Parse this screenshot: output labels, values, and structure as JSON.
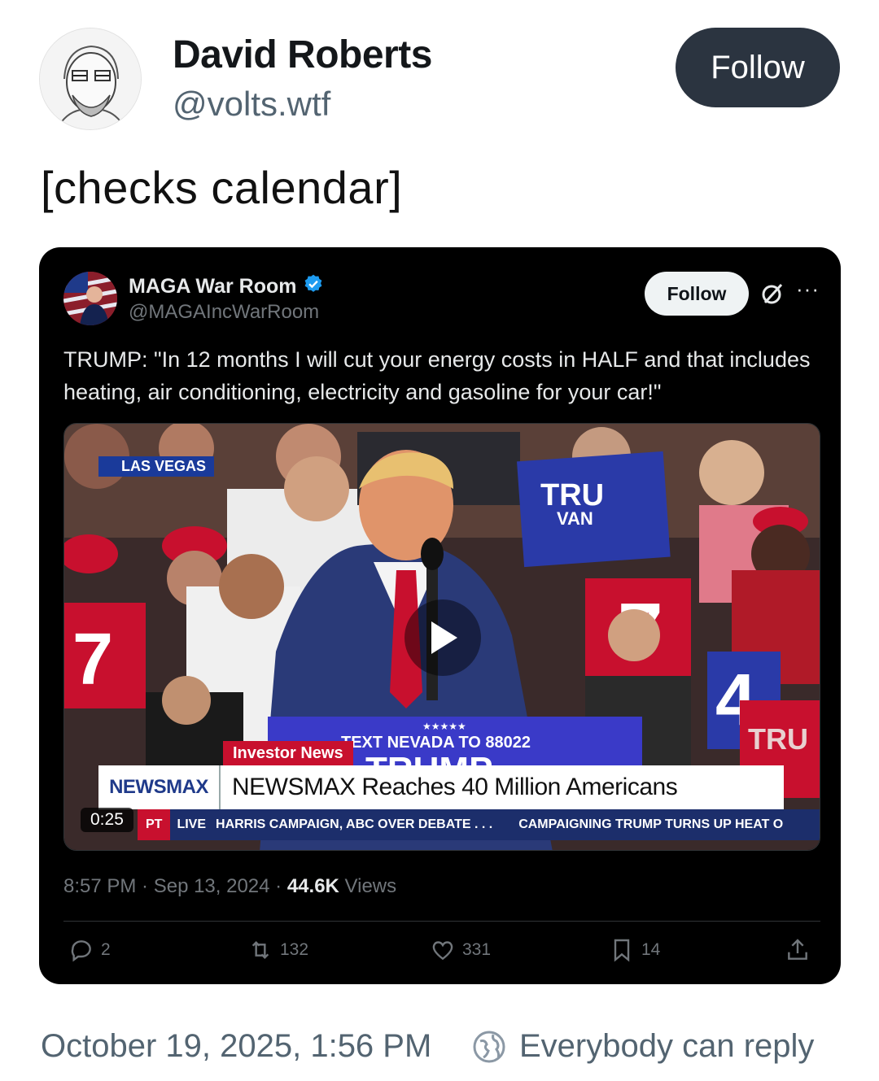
{
  "author": {
    "name": "David Roberts",
    "handle": "@volts.wtf"
  },
  "follow_label": "Follow",
  "post_text": "[checks calendar]",
  "embed": {
    "name": "MAGA War Room",
    "handle": "@MAGAIncWarRoom",
    "follow_label": "Follow",
    "more": "···",
    "text": "TRUMP: \"In 12 months I will cut your energy costs in HALF and that includes heating, air conditioning, electricity and gasoline for your car!\"",
    "video": {
      "location_tag": "LAS VEGAS",
      "lower_tag": "Investor News",
      "chyron_logo": "NEWSMAX",
      "chyron_text": "NEWSMAX Reaches 40 Million Americans",
      "ticker_pt": "PT",
      "ticker_live": "LIVE",
      "ticker_1": "HARRIS CAMPAIGN, ABC OVER DEBATE . . .",
      "ticker_2": "CAMPAIGNING TRUMP TURNS UP HEAT O",
      "duration": "0:25"
    },
    "meta": {
      "time": "8:57 PM · Sep 13, 2024 · ",
      "views_count": "44.6K",
      "views_label": " Views"
    },
    "actions": {
      "replies": "2",
      "reposts": "132",
      "likes": "331",
      "bookmarks": "14"
    }
  },
  "footer": {
    "date": "October 19, 2025, 1:56 PM",
    "reply_setting": "Everybody can reply"
  },
  "colors": {
    "follow_bg": "#2b3440",
    "embed_bg": "#000000",
    "newsmax_blue": "#1c2e6b",
    "newsmax_red": "#c8102e",
    "verified": "#1d9bf0"
  }
}
